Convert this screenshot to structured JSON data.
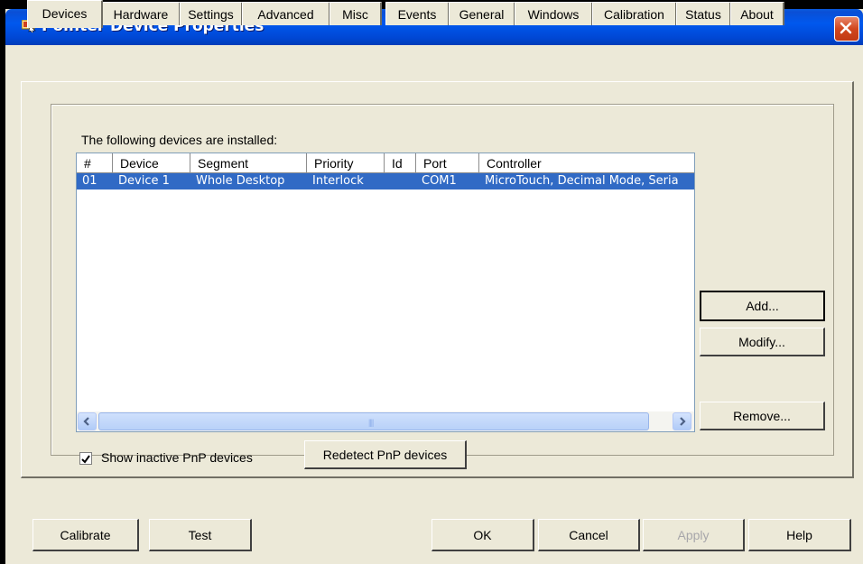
{
  "window": {
    "title": "Pointer Device Properties"
  },
  "tabs": [
    {
      "label": "Devices"
    },
    {
      "label": "Hardware"
    },
    {
      "label": "Settings"
    },
    {
      "label": "Advanced"
    },
    {
      "label": "Misc"
    },
    {
      "label": "Events"
    },
    {
      "label": "General"
    },
    {
      "label": "Windows"
    },
    {
      "label": "Calibration"
    },
    {
      "label": "Status"
    },
    {
      "label": "About"
    }
  ],
  "active_tab": "Devices",
  "devices_panel": {
    "caption": "The following devices are installed:",
    "columns": [
      "#",
      "Device",
      "Segment",
      "Priority",
      "Id",
      "Port",
      "Controller"
    ],
    "rows": [
      {
        "num": "01",
        "device": "Device 1",
        "segment": "Whole Desktop",
        "priority": "Interlock",
        "id": "",
        "port": "COM1",
        "controller": "MicroTouch, Decimal Mode, Seria"
      }
    ],
    "selected_row": 0,
    "buttons": {
      "add": "Add...",
      "modify": "Modify...",
      "remove": "Remove..."
    },
    "show_inactive": {
      "label": "Show inactive PnP devices",
      "checked": true
    },
    "redetect_label": "Redetect PnP devices"
  },
  "footer": {
    "calibrate": "Calibrate",
    "test": "Test",
    "ok": "OK",
    "cancel": "Cancel",
    "apply": "Apply",
    "help": "Help"
  },
  "colors": {
    "titlebar": "#0058EE",
    "selection": "#316AC5",
    "face": "#ECE9D8",
    "close": "#D1461D"
  }
}
